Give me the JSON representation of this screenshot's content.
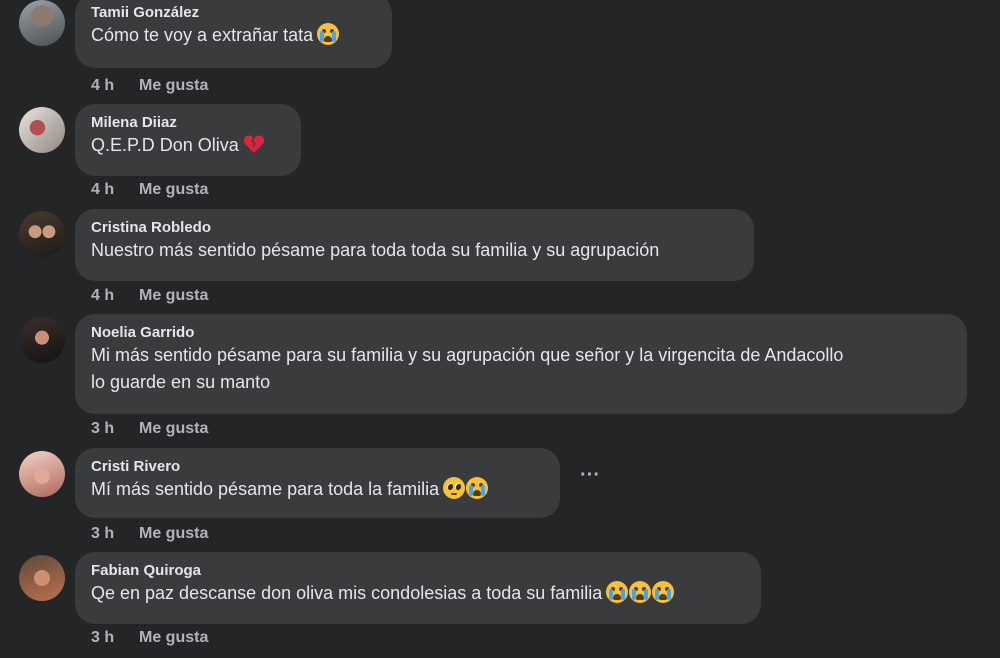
{
  "comments": [
    {
      "author": "Tamii González",
      "text": "Cómo te voy a extrañar tata",
      "emoji": [
        "crying-face"
      ],
      "time": "4 h",
      "like": "Me gusta"
    },
    {
      "author": "Milena Diiaz",
      "text": "Q.E.P.D Don Oliva",
      "emoji": [
        "broken-heart"
      ],
      "time": "4 h",
      "like": "Me gusta"
    },
    {
      "author": "Cristina Robledo",
      "text": "Nuestro más sentido pésame para toda toda su familia y su agrupación",
      "emoji": [],
      "time": "4 h",
      "like": "Me gusta"
    },
    {
      "author": "Noelia Garrido",
      "text": "Mi más sentido pésame para su familia y su agrupación que señor y la virgencita de Andacollo\nlo guarde en su manto",
      "emoji": [],
      "time": "3 h",
      "like": "Me gusta"
    },
    {
      "author": "Cristi Rivero",
      "text": "Mí más sentido pésame para toda la familia",
      "emoji": [
        "pleading-face",
        "crying-face"
      ],
      "time": "3 h",
      "like": "Me gusta"
    },
    {
      "author": "Fabian Quiroga",
      "text": "Qe en paz descanse don oliva mis condolesias a toda su familia",
      "emoji": [
        "crying-face",
        "crying-face",
        "crying-face"
      ],
      "time": "3 h",
      "like": "Me gusta"
    }
  ],
  "colors": {
    "background": "#242526",
    "bubble": "#3a3b3c",
    "text": "#e4e6eb",
    "secondary": "#b0b3b8"
  },
  "icons": {
    "more_options": "more-options-icon"
  }
}
